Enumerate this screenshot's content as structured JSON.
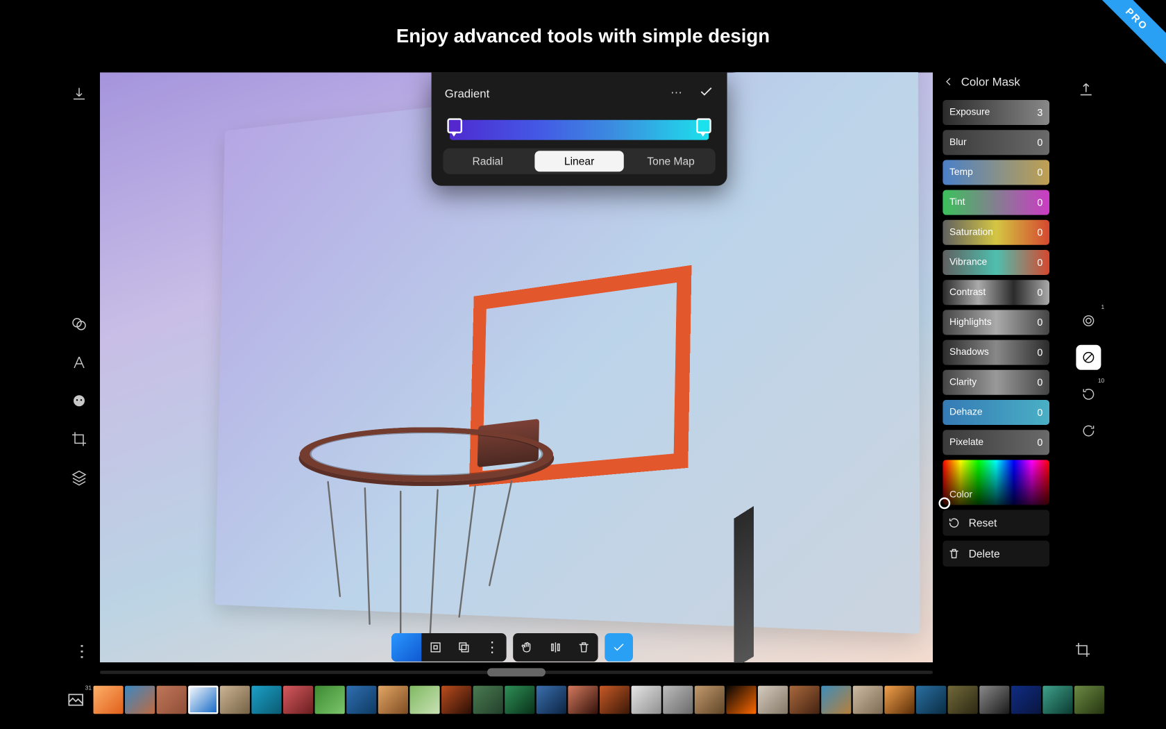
{
  "pro_badge": "PRO",
  "tagline": "Enjoy advanced tools with simple design",
  "gradient_panel": {
    "title": "Gradient",
    "tabs": {
      "radial": "Radial",
      "linear": "Linear",
      "tone_map": "Tone Map"
    },
    "active_tab": "Linear",
    "stop_left": "#5427cf",
    "stop_right": "#1be1ec"
  },
  "mask_panel": {
    "title": "Color Mask",
    "sliders": {
      "exposure": {
        "label": "Exposure",
        "value": "3"
      },
      "blur": {
        "label": "Blur",
        "value": "0"
      },
      "temp": {
        "label": "Temp",
        "value": "0"
      },
      "tint": {
        "label": "Tint",
        "value": "0"
      },
      "saturation": {
        "label": "Saturation",
        "value": "0"
      },
      "vibrance": {
        "label": "Vibrance",
        "value": "0"
      },
      "contrast": {
        "label": "Contrast",
        "value": "0"
      },
      "highlights": {
        "label": "Highlights",
        "value": "0"
      },
      "shadows": {
        "label": "Shadows",
        "value": "0"
      },
      "clarity": {
        "label": "Clarity",
        "value": "0"
      },
      "dehaze": {
        "label": "Dehaze",
        "value": "0"
      },
      "pixelate": {
        "label": "Pixelate",
        "value": "0"
      }
    },
    "color_label": "Color",
    "reset": "Reset",
    "delete": "Delete"
  },
  "right_tools": {
    "history_badge": "10",
    "record_badge": "1"
  },
  "gallery": {
    "count_badge": "31",
    "selected_index": 3,
    "thumbs": [
      "linear-gradient(135deg,#fdb06a,#e15f1a)",
      "linear-gradient(135deg,#3b88c2,#bf6a3f)",
      "linear-gradient(135deg,#c07759,#8f4e38)",
      "linear-gradient(135deg,#ffffff,#0a63c4)",
      "linear-gradient(135deg,#cbb594,#746044)",
      "linear-gradient(135deg,#1ca0c8,#0a5b71)",
      "linear-gradient(135deg,#d65a5e,#6a1d20)",
      "linear-gradient(135deg,#3c8a32,#7cc66c)",
      "linear-gradient(135deg,#2f6fb1,#0e3a63)",
      "linear-gradient(135deg,#e3a664,#7d4c23)",
      "linear-gradient(135deg,#7fb961,#c9e1b5)",
      "linear-gradient(135deg,#bb4d1e,#2a0e05)",
      "linear-gradient(135deg,#4a7b52,#23402a)",
      "linear-gradient(135deg,#2f8f57,#083119)",
      "linear-gradient(135deg,#3b6fae,#0b2442)",
      "linear-gradient(135deg,#d57a5e,#32110a)",
      "linear-gradient(135deg,#c75926,#3a1807)",
      "linear-gradient(135deg,#e5e5e5,#909090)",
      "linear-gradient(135deg,#bdbdbd,#6a6a6a)",
      "linear-gradient(135deg,#c29a6e,#5f4527)",
      "linear-gradient(135deg,#050505,#ff6a00)",
      "linear-gradient(135deg,#d5cbbf,#847766)",
      "linear-gradient(135deg,#a9693d,#432211)",
      "linear-gradient(135deg,#3d8dbb,#b87f3a)",
      "linear-gradient(135deg,#cdbba4,#7c6a52)",
      "linear-gradient(135deg,#f2a14c,#5b2d07)",
      "linear-gradient(135deg,#2a6fa1,#0a2d44)",
      "linear-gradient(135deg,#726a3a,#2c2813)",
      "linear-gradient(135deg,#8a8a8a,#1a1a1a)",
      "linear-gradient(135deg,#0f2d82,#0a1540)",
      "linear-gradient(135deg,#3fa18b,#0b3a30)",
      "linear-gradient(135deg,#6b8a44,#25340f)"
    ]
  }
}
